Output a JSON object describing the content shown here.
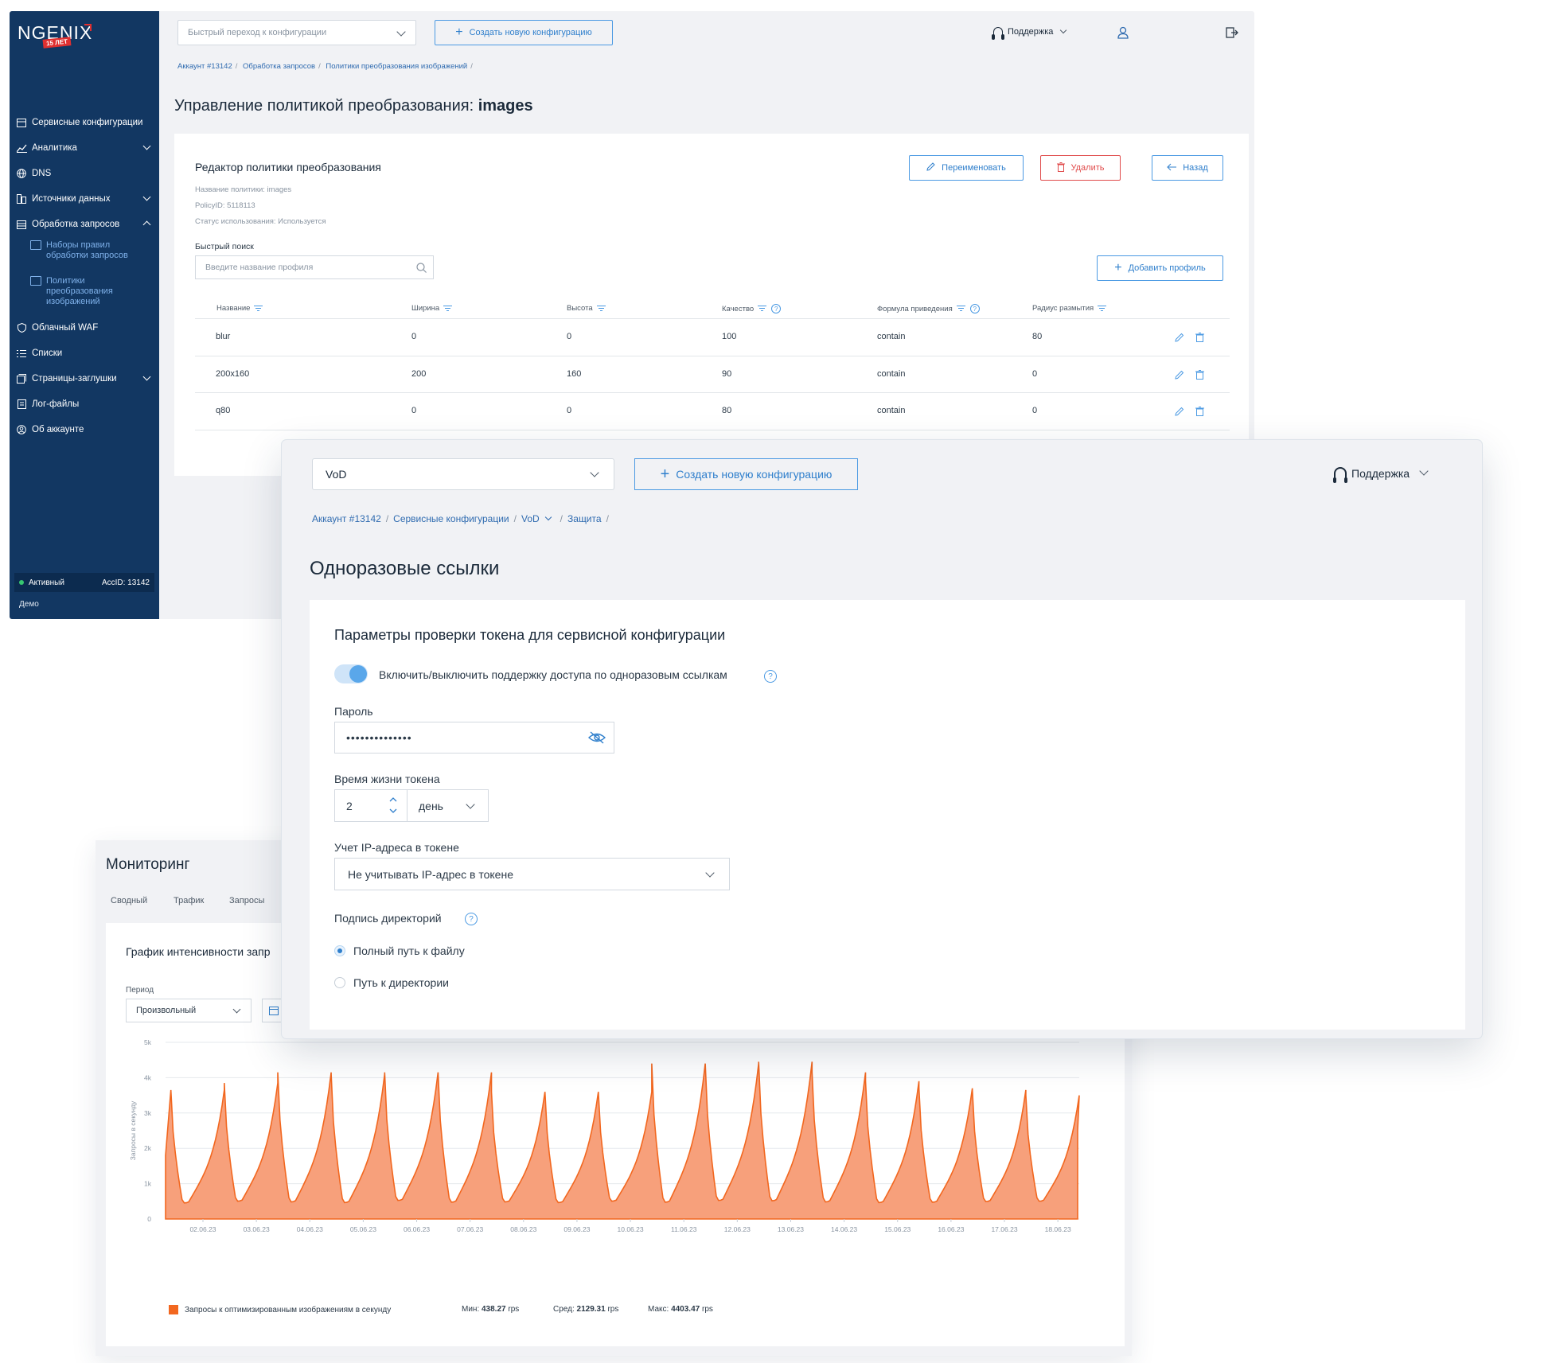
{
  "console": {
    "brand": "NGENIX",
    "brand_badge": "15 ЛЕТ",
    "quick_jump_placeholder": "Быстрый переход к конфигурации",
    "create_config_label": "Создать новую конфигурацию",
    "support_label": "Поддержка",
    "breadcrumb": [
      "Аккаунт #13142",
      "Обработка запросов",
      "Политики преобразования изображений"
    ],
    "page_title_prefix": "Управление политикой преобразования:",
    "page_title_name": "images",
    "sidebar": {
      "items": [
        {
          "label": "Сервисные конфигурации",
          "icon": "service-config-icon"
        },
        {
          "label": "Аналитика",
          "icon": "analytics-icon"
        },
        {
          "label": "DNS",
          "icon": "globe-icon"
        },
        {
          "label": "Источники данных",
          "icon": "sources-icon"
        },
        {
          "label": "Обработка запросов",
          "icon": "requests-icon"
        },
        {
          "label": "Облачный WAF",
          "icon": "shield-icon"
        },
        {
          "label": "Списки",
          "icon": "list-icon"
        },
        {
          "label": "Страницы-заглушки",
          "icon": "pages-icon"
        },
        {
          "label": "Лог-файлы",
          "icon": "log-icon"
        },
        {
          "label": "Об аккаунте",
          "icon": "account-icon"
        }
      ],
      "subitems": [
        "Наборы правил обработки запросов",
        "Политики преобразования изображений"
      ],
      "status": "Активный",
      "acc_id": "AccID: 13142",
      "account_name": "Демо"
    },
    "editor": {
      "title": "Редактор политики преобразования",
      "policy_name": "Название политики: images",
      "policy_id": "PolicyID: 5118113",
      "usage_status": "Статус использования: Используется",
      "rename_label": "Переименовать",
      "delete_label": "Удалить",
      "back_label": "Назад",
      "search_label": "Быстрый поиск",
      "search_placeholder": "Введите название профиля",
      "add_profile_label": "Добавить профиль",
      "columns": [
        "Название",
        "Ширина",
        "Высота",
        "Качество",
        "Формула приведения",
        "Радиус размытия"
      ],
      "rows": [
        [
          "blur",
          "0",
          "0",
          "100",
          "contain",
          "80"
        ],
        [
          "200x160",
          "200",
          "160",
          "90",
          "contain",
          "0"
        ],
        [
          "q80",
          "0",
          "0",
          "80",
          "contain",
          "0"
        ]
      ]
    }
  },
  "monitoring": {
    "title": "Мониторинг",
    "tabs": [
      "Сводный",
      "Трафик",
      "Запросы"
    ],
    "chart_title": "График интенсивности запр",
    "period_label": "Период",
    "period_value": "Произвольный",
    "legend_label": "Запросы к оптимизированным изображениям в секунду",
    "stats": [
      {
        "label": "Мин:",
        "value": "438.27",
        "unit": "rps"
      },
      {
        "label": "Сред:",
        "value": "2129.31",
        "unit": "rps"
      },
      {
        "label": "Макс:",
        "value": "4403.47",
        "unit": "rps"
      }
    ],
    "series_color": "#f2671f"
  },
  "chart_data": {
    "type": "area",
    "title": "",
    "xlabel": "",
    "ylabel": "Запросы в секунду",
    "ylim": [
      0,
      5000
    ],
    "y_ticks": [
      "0",
      "1k",
      "2k",
      "3k",
      "4k",
      "5k"
    ],
    "x_ticks": [
      "02.06.23",
      "03.06.23",
      "04.06.23",
      "05.06.23",
      "06.06.23",
      "07.06.23",
      "08.06.23",
      "09.06.23",
      "10.06.23",
      "11.06.23",
      "12.06.23",
      "13.06.23",
      "14.06.23",
      "15.06.23",
      "16.06.23",
      "17.06.23",
      "18.06.23"
    ],
    "grid": true,
    "series": [
      {
        "name": "Запросы к оптимизированным изображениям в секунду",
        "daily_min": [
          450,
          500,
          480,
          460,
          520,
          470,
          480,
          460,
          500,
          470,
          520,
          510,
          480,
          460,
          470,
          490,
          500
        ],
        "daily_max": [
          3650,
          3850,
          4150,
          4100,
          4150,
          4150,
          3600,
          3600,
          3600,
          4400,
          4400,
          4450,
          4150,
          3900,
          3700,
          3650,
          3500
        ]
      }
    ]
  },
  "onetime": {
    "config_select": "VoD",
    "create_config_label": "Создать новую конфигурацию",
    "support_label": "Поддержка",
    "breadcrumb": [
      "Аккаунт #13142",
      "Сервисные конфигурации",
      "VoD",
      "Защита"
    ],
    "page_title": "Одноразовые ссылки",
    "section_title": "Параметры проверки токена для сервисной конфигурации",
    "toggle_label": "Включить/выключить поддержку доступа по одноразовым ссылкам",
    "toggle_on": true,
    "password_label": "Пароль",
    "password_value": "••••••••••••••",
    "ttl_label": "Время жизни токена",
    "ttl_value": "2",
    "ttl_unit": "день",
    "ip_label": "Учет IP-адреса в токене",
    "ip_value": "Не учитывать IP-адрес в токене",
    "dir_sign_label": "Подпись директорий",
    "radio_full": "Полный путь к файлу",
    "radio_dir": "Путь к директории",
    "accent": "#2f7fcc"
  }
}
